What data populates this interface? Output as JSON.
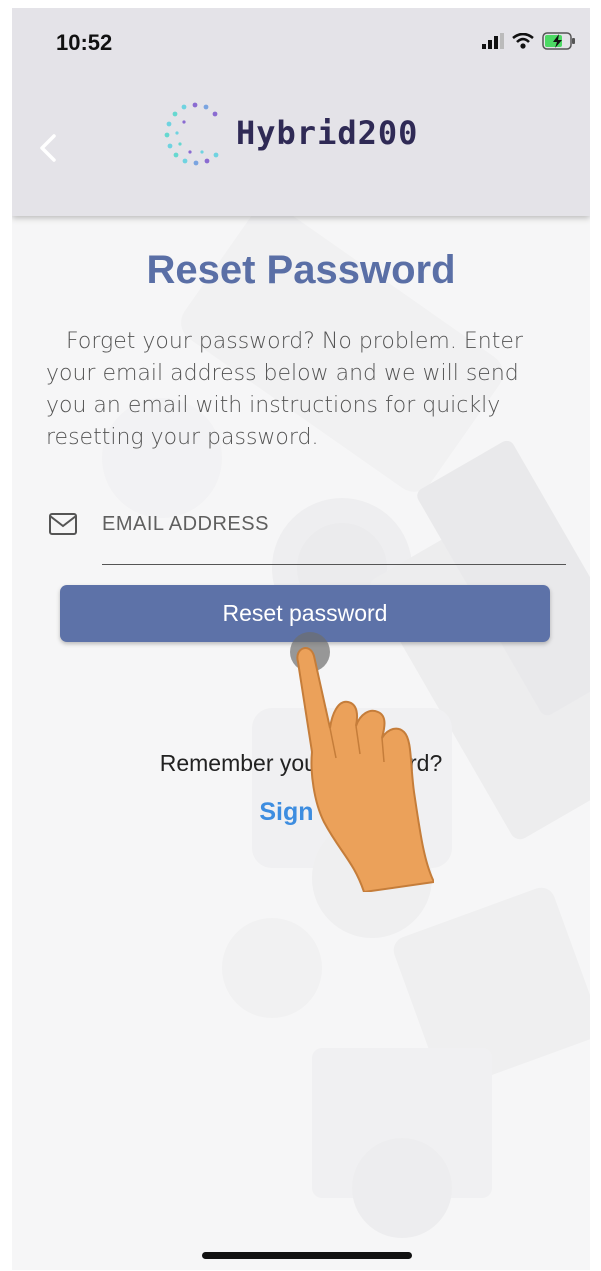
{
  "status_bar": {
    "time": "10:52"
  },
  "header": {
    "logo_text": "Hybrid200",
    "back_icon": "chevron-left-icon"
  },
  "page": {
    "title": "Reset Password",
    "description": "Forget your password? No problem. Enter your email address below and we will send you an email with instructions for quickly resetting your password."
  },
  "form": {
    "email_placeholder": "EMAIL ADDRESS",
    "email_value": "",
    "submit_label": "Reset password"
  },
  "footer": {
    "remember_text": "Remember your password?",
    "signin_label": "Sign In"
  },
  "colors": {
    "accent": "#5d72a8",
    "title": "#5a6fa6",
    "link": "#3d8de0",
    "header_bg": "#e4e3e8"
  }
}
